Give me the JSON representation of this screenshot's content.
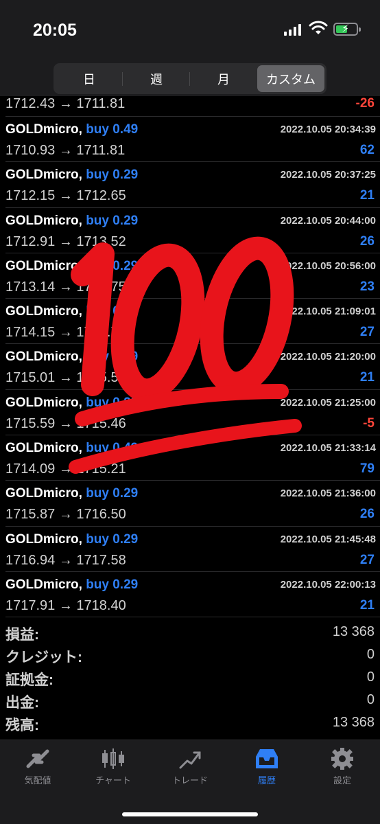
{
  "status": {
    "time": "20:05"
  },
  "periods": [
    {
      "label": "日",
      "active": false
    },
    {
      "label": "週",
      "active": false
    },
    {
      "label": "月",
      "active": false
    },
    {
      "label": "カスタム",
      "active": true
    }
  ],
  "first_row": {
    "prices": "1712.43 → 1711.81",
    "profit": "-26"
  },
  "deals": [
    {
      "symbol": "GOLDmicro,",
      "side": "buy 0.49",
      "date": "2022.10.05 20:34:39",
      "prices": "1710.93 → 1711.81",
      "profit": "62"
    },
    {
      "symbol": "GOLDmicro,",
      "side": "buy 0.29",
      "date": "2022.10.05 20:37:25",
      "prices": "1712.15 → 1712.65",
      "profit": "21"
    },
    {
      "symbol": "GOLDmicro,",
      "side": "buy 0.29",
      "date": "2022.10.05 20:44:00",
      "prices": "1712.91 → 1713.52",
      "profit": "26"
    },
    {
      "symbol": "GOLDmicro,",
      "side": "buy 0.29",
      "date": "2022.10.05 20:56:00",
      "prices": "1713.14 → 1713.75",
      "profit": "23"
    },
    {
      "symbol": "GOLDmicro,",
      "side": "buy 0.29",
      "date": "2022.10.05 21:09:01",
      "prices": "1714.15 → 1714.79",
      "profit": "27"
    },
    {
      "symbol": "GOLDmicro,",
      "side": "buy 0.29",
      "date": "2022.10.05 21:20:00",
      "prices": "1715.01 → 1715.52",
      "profit": "21"
    },
    {
      "symbol": "GOLDmicro,",
      "side": "buy 0.29",
      "date": "2022.10.05 21:25:00",
      "prices": "1715.59 → 1715.46",
      "profit": "-5"
    },
    {
      "symbol": "GOLDmicro,",
      "side": "buy 0.49",
      "date": "2022.10.05 21:33:14",
      "prices": "1714.09 → 1715.21",
      "profit": "79"
    },
    {
      "symbol": "GOLDmicro,",
      "side": "buy 0.29",
      "date": "2022.10.05 21:36:00",
      "prices": "1715.87 → 1716.50",
      "profit": "26"
    },
    {
      "symbol": "GOLDmicro,",
      "side": "buy 0.29",
      "date": "2022.10.05 21:45:48",
      "prices": "1716.94 → 1717.58",
      "profit": "27"
    },
    {
      "symbol": "GOLDmicro,",
      "side": "buy 0.29",
      "date": "2022.10.05 22:00:13",
      "prices": "1717.91 → 1718.40",
      "profit": "21"
    }
  ],
  "summary": [
    {
      "label": "損益:",
      "value": "13 368"
    },
    {
      "label": "クレジット:",
      "value": "0"
    },
    {
      "label": "証拠金:",
      "value": "0"
    },
    {
      "label": "出金:",
      "value": "0"
    },
    {
      "label": "残高:",
      "value": "13 368"
    }
  ],
  "tabs": [
    {
      "label": "気配値",
      "icon": "quotes-icon",
      "active": false
    },
    {
      "label": "チャート",
      "icon": "chart-icon",
      "active": false
    },
    {
      "label": "トレード",
      "icon": "trade-icon",
      "active": false
    },
    {
      "label": "履歴",
      "icon": "history-icon",
      "active": true
    },
    {
      "label": "設定",
      "icon": "gear-icon",
      "active": false
    }
  ],
  "colors": {
    "positive": "#2f7ff5",
    "negative": "#ff453a",
    "accent": "#2f7ff5",
    "sticker": "#e8141b"
  },
  "overlay": {
    "icon": "hundred-points-emoji-icon"
  }
}
